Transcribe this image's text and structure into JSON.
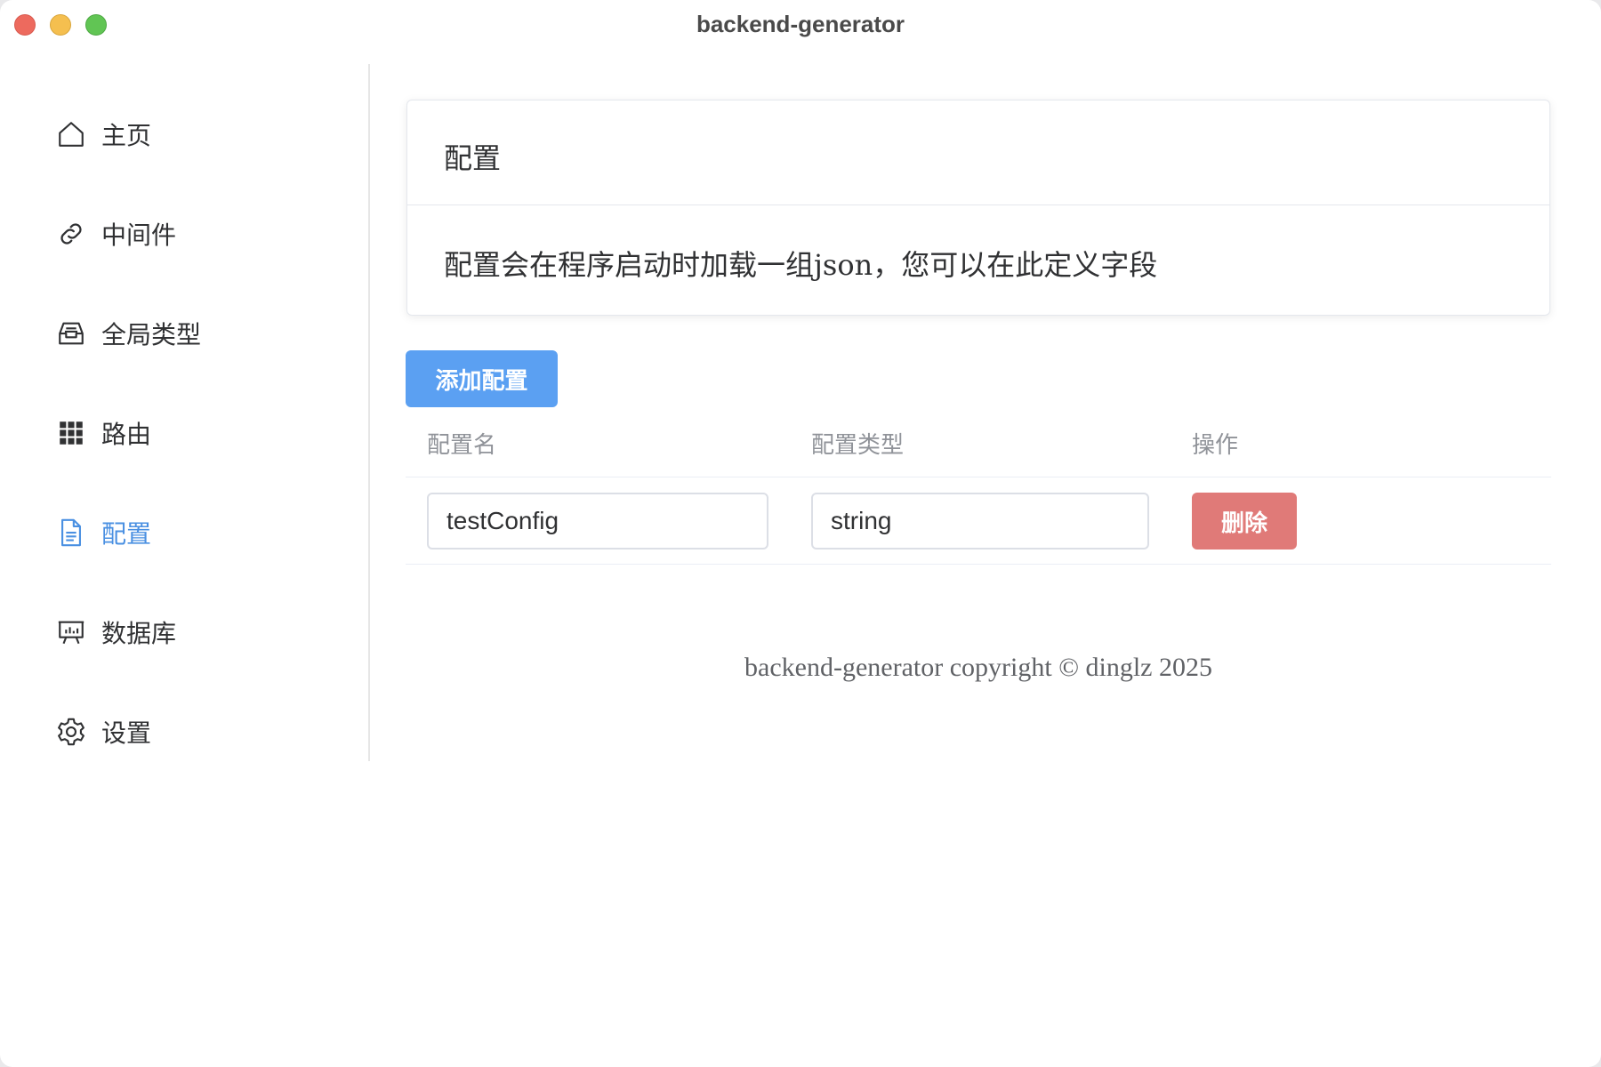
{
  "window": {
    "title": "backend-generator"
  },
  "sidebar": {
    "items": [
      {
        "label": "主页",
        "icon": "home-icon",
        "active": false
      },
      {
        "label": "中间件",
        "icon": "link-icon",
        "active": false
      },
      {
        "label": "全局类型",
        "icon": "inbox-icon",
        "active": false
      },
      {
        "label": "路由",
        "icon": "grid-icon",
        "active": false
      },
      {
        "label": "配置",
        "icon": "document-icon",
        "active": true
      },
      {
        "label": "数据库",
        "icon": "presentation-icon",
        "active": false
      },
      {
        "label": "设置",
        "icon": "gear-icon",
        "active": false
      }
    ]
  },
  "card": {
    "title": "配置",
    "description": "配置会在程序启动时加载一组json，您可以在此定义字段"
  },
  "toolbar": {
    "add_label": "添加配置"
  },
  "table": {
    "headers": [
      "配置名",
      "配置类型",
      "操作"
    ],
    "rows": [
      {
        "name": "testConfig",
        "type": "string",
        "action_label": "删除"
      }
    ]
  },
  "footer": {
    "text": "backend-generator copyright © dinglz 2025"
  },
  "colors": {
    "accent": "#4a90e2",
    "primary_button": "#5ba0f2",
    "danger_button": "#e07a78"
  }
}
